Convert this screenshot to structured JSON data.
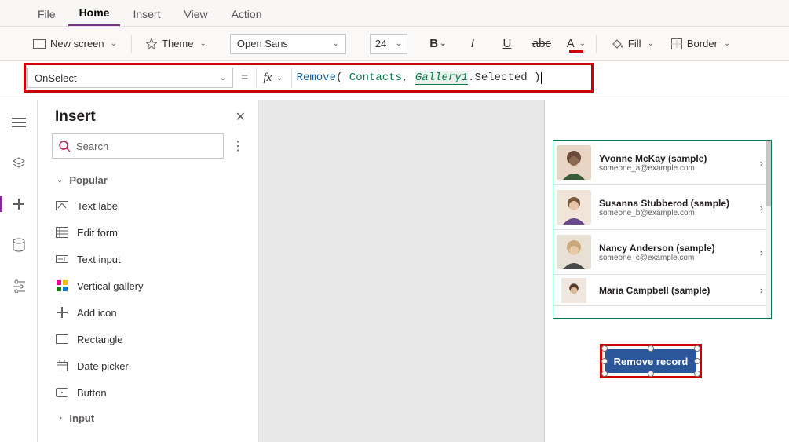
{
  "tabs": {
    "file": "File",
    "home": "Home",
    "insert": "Insert",
    "view": "View",
    "action": "Action"
  },
  "ribbon": {
    "new_screen": "New screen",
    "theme": "Theme",
    "font": "Open Sans",
    "size": "24",
    "fill": "Fill",
    "border": "Border"
  },
  "formula": {
    "property": "OnSelect",
    "fn": "Remove",
    "arg1": "Contacts",
    "ref": "Gallery1",
    "suffix": ".Selected"
  },
  "panel": {
    "title": "Insert",
    "search_placeholder": "Search",
    "section_popular": "Popular",
    "section_input": "Input",
    "items": {
      "text_label": "Text label",
      "edit_form": "Edit form",
      "text_input": "Text input",
      "vertical_gallery": "Vertical gallery",
      "add_icon": "Add icon",
      "rectangle": "Rectangle",
      "date_picker": "Date picker",
      "button": "Button"
    }
  },
  "gallery": {
    "rows": [
      {
        "name": "Yvonne McKay (sample)",
        "email": "someone_a@example.com"
      },
      {
        "name": "Susanna Stubberod (sample)",
        "email": "someone_b@example.com"
      },
      {
        "name": "Nancy Anderson (sample)",
        "email": "someone_c@example.com"
      },
      {
        "name": "Maria Campbell (sample)",
        "email": ""
      }
    ]
  },
  "button": {
    "label": "Remove record"
  }
}
